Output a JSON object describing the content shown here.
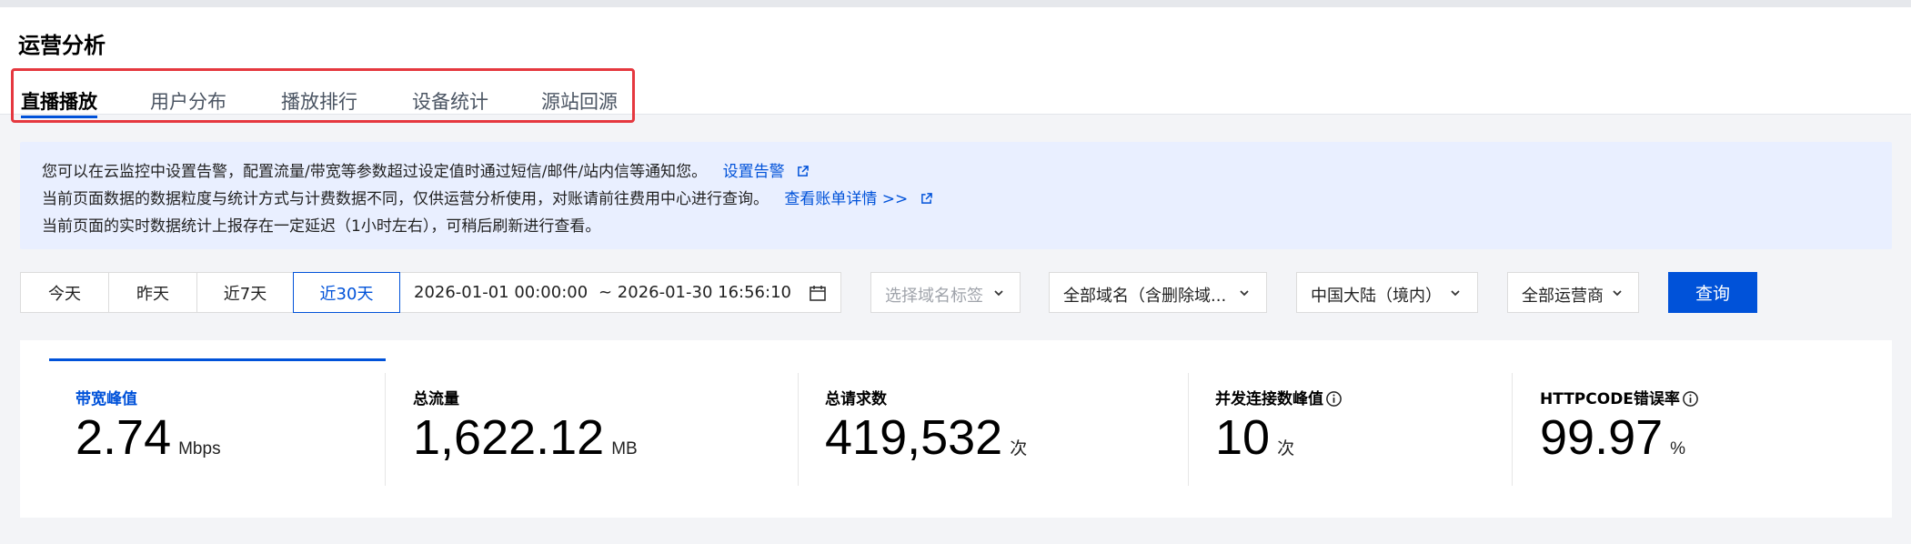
{
  "page": {
    "title": "运营分析"
  },
  "tabs": [
    {
      "label": "直播播放",
      "active": true
    },
    {
      "label": "用户分布",
      "active": false
    },
    {
      "label": "播放排行",
      "active": false
    },
    {
      "label": "设备统计",
      "active": false
    },
    {
      "label": "源站回源",
      "active": false
    }
  ],
  "notice": {
    "line1": "您可以在云监控中设置告警，配置流量/带宽等参数超过设定值时通过短信/邮件/站内信等通知您。",
    "line1_link": "设置告警",
    "line2": "当前页面数据的数据粒度与统计方式与计费数据不同，仅供运营分析使用，对账请前往费用中心进行查询。",
    "line2_link": "查看账单详情 >>",
    "line3": "当前页面的实时数据统计上报存在一定延迟（1小时左右），可稍后刷新进行查看。"
  },
  "filters": {
    "time_ranges": [
      "今天",
      "昨天",
      "近7天",
      "近30天"
    ],
    "active_range": "近30天",
    "start_time": "2026-01-01 00:00:00",
    "end_time": "~ 2026-01-30 16:56:10",
    "domain_tag_placeholder": "选择域名标签",
    "domain_select": "全部域名（含删除域...",
    "region_select": "中国大陆（境内）",
    "isp_select": "全部运营商",
    "query_label": "查询"
  },
  "stats": [
    {
      "label": "带宽峰值",
      "value": "2.74",
      "unit": "Mbps",
      "active": true
    },
    {
      "label": "总流量",
      "value": "1,622.12",
      "unit": "MB",
      "active": false
    },
    {
      "label": "总请求数",
      "value": "419,532",
      "unit": "次",
      "active": false
    },
    {
      "label": "并发连接数峰值",
      "value": "10",
      "unit": "次",
      "active": false
    },
    {
      "label": "HTTPCODE错误率",
      "value": "99.97",
      "unit": "%",
      "active": false
    }
  ],
  "colors": {
    "accent": "#0052d9",
    "highlight_border": "#e5383f",
    "notice_bg": "#e9efff"
  }
}
